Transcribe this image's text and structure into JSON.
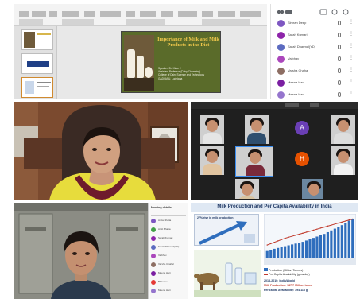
{
  "ppt": {
    "slide_title": "Importance of Milk and Milk Products in the Diet",
    "slide_lines": [
      "Speaker: Dr. Kiran J",
      "Assistant Professor (Dairy Chemistry)",
      "College of Dairy Science and Technology",
      "GADVASU, Ludhiana"
    ]
  },
  "participants": {
    "people": [
      {
        "name": "Simran Deep",
        "color": "#7e57c2"
      },
      {
        "name": "Sarah Kumari",
        "color": "#8e24aa"
      },
      {
        "name": "Sarah Dharmal(YD)",
        "color": "#5c6bc0"
      },
      {
        "name": "Vaibhav",
        "color": "#ab47bc"
      },
      {
        "name": "Varsha Chahal",
        "color": "#8d6e63"
      },
      {
        "name": "Meena Hari",
        "color": "#7b1fa2"
      },
      {
        "name": "Meena Hari",
        "color": "#9575cd"
      }
    ]
  },
  "grid": {
    "initials": [
      "A",
      "H"
    ],
    "initial_colors": [
      "#6a3fb5",
      "#e65100"
    ]
  },
  "meeting": {
    "header": "Meeting details",
    "people": [
      {
        "name": "Anita Bhatia",
        "color": "#7e57c2"
      },
      {
        "name": "Arpit Bhatia",
        "color": "#43a047"
      },
      {
        "name": "Sarah Kumari",
        "color": "#8e24aa"
      },
      {
        "name": "Sarah Dharmal(YD)",
        "color": "#5c6bc0"
      },
      {
        "name": "Vaibhav",
        "color": "#ab47bc"
      },
      {
        "name": "Varsha Chahal",
        "color": "#8d6e63"
      },
      {
        "name": "Meena Hari",
        "color": "#7b1fa2"
      },
      {
        "name": "Bhavneet",
        "color": "#e53935"
      },
      {
        "name": "Meena Hari",
        "color": "#9575cd"
      }
    ]
  },
  "chart": {
    "title": "Milk Production and Per Capita Availability in India",
    "inset_label": "27% rise in milk production",
    "legend": [
      "Production (Million Tonnes)",
      "Per Capita Availability (gms/day)"
    ],
    "facts": [
      "2018-2019: India/World",
      "Milk Production: 187.7 Million tonne",
      "Per capita Availability: 394/113 g"
    ],
    "colors": {
      "bar": "#2f6ebd",
      "line": "#c0392b"
    }
  },
  "chart_data": {
    "type": "bar",
    "title": "Milk Production and Per Capita Availability in India",
    "series": [
      {
        "name": "Production (Million Tonnes)",
        "values": [
          17,
          20,
          22,
          24,
          26,
          28,
          30,
          32,
          34,
          36,
          38,
          41,
          44,
          47,
          50,
          53,
          56,
          60,
          64,
          68,
          72,
          76,
          81,
          86,
          90
        ]
      },
      {
        "name": "Per Capita Availability (gms/day)",
        "values": [
          40,
          44,
          48,
          52,
          56,
          60,
          63,
          66,
          69,
          72,
          75,
          78,
          81,
          84,
          87,
          90,
          93,
          96,
          99,
          102,
          105,
          108,
          111,
          114,
          117
        ]
      }
    ]
  }
}
